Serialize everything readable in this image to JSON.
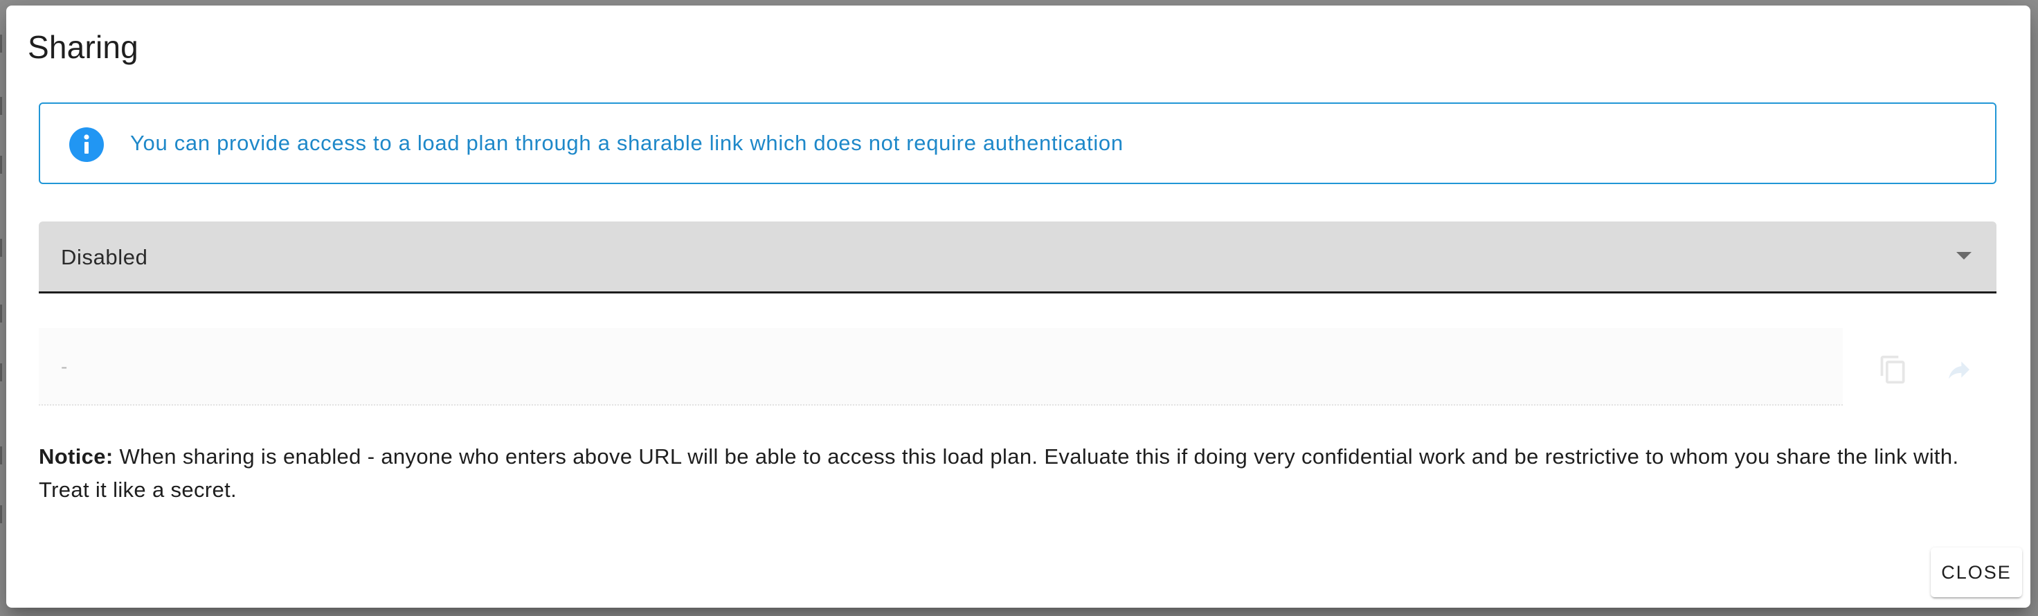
{
  "dialog": {
    "title": "Sharing",
    "info_alert": {
      "icon": "info-icon",
      "text": "You can provide access to a load plan through a sharable link which does not require authentication",
      "color": "#2196f3"
    },
    "sharing_select": {
      "selected_value": "Disabled",
      "icon": "chevron-down-icon"
    },
    "share_url": {
      "value": "-",
      "copy_icon": "copy-icon",
      "share_icon": "share-icon"
    },
    "notice": {
      "label": "Notice:",
      "text": " When sharing is enabled - anyone who enters above URL will be able to access this load plan. Evaluate this if doing very confidential work and be restrictive to whom you share the link with. Treat it like a secret."
    },
    "close_label": "CLOSE"
  }
}
